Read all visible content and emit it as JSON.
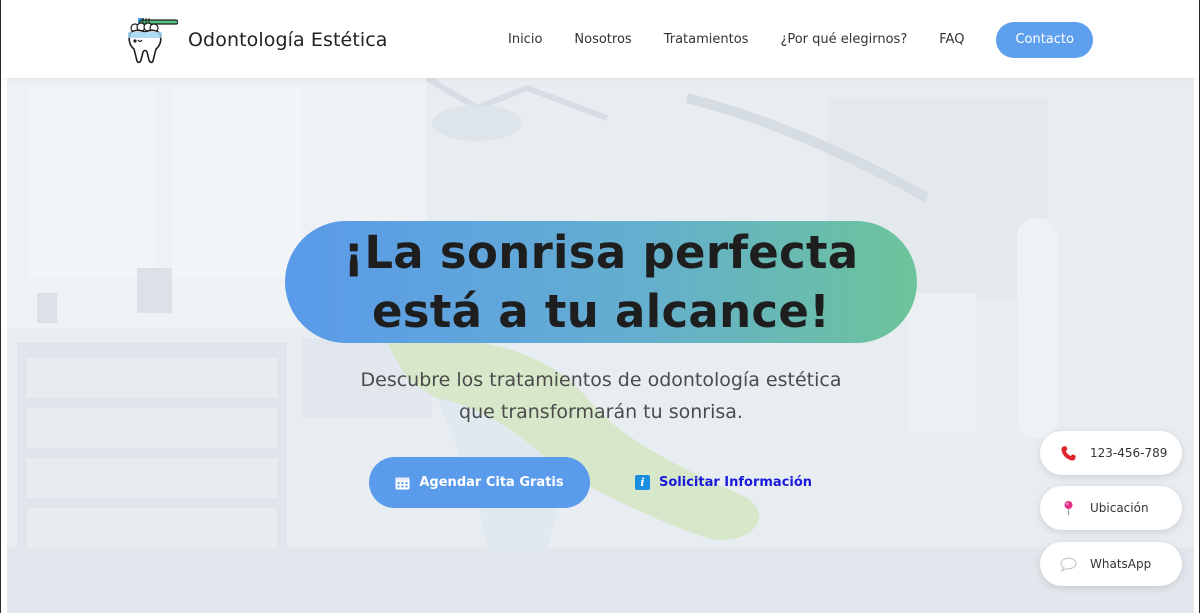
{
  "brand": {
    "name": "Odontología Estética",
    "logo_icon": "tooth-with-toothbrush-icon"
  },
  "nav": {
    "items": [
      "Inicio",
      "Nosotros",
      "Tratamientos",
      "¿Por qué elegirnos?",
      "FAQ"
    ],
    "contact_label": "Contacto"
  },
  "hero": {
    "headline_line1": "¡La sonrisa perfecta",
    "headline_line2": "está a tu alcance!",
    "subtitle_line1": "Descubre los tratamientos de odontología estética",
    "subtitle_line2": "que transformarán tu sonrisa.",
    "primary_cta": {
      "label": "Agendar Cita Gratis",
      "icon": "calendar-icon"
    },
    "secondary_cta": {
      "label": "Solicitar Información",
      "icon": "info-icon"
    }
  },
  "floating": {
    "phone": {
      "label": "123-456-789",
      "icon": "phone-icon"
    },
    "location": {
      "label": "Ubicación",
      "icon": "pushpin-icon"
    },
    "whatsapp": {
      "label": "WhatsApp",
      "icon": "chat-bubble-icon"
    }
  },
  "colors": {
    "accent": "#5fa0ee",
    "pill_gradient_start": "#5a9aea",
    "pill_gradient_end": "#6cc49a",
    "link": "#1a1adb"
  }
}
